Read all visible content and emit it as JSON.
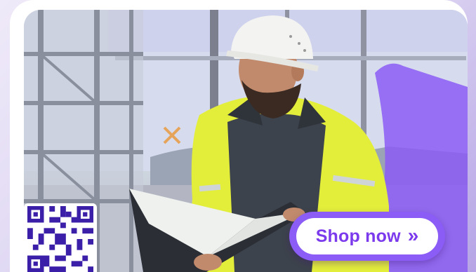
{
  "cta": {
    "label": "Shop now",
    "icon": "double-chevron-right-icon",
    "accent_color": "#8b5cf6",
    "text_color": "#7c3aed"
  },
  "qr": {
    "icon": "qr-code-icon",
    "color": "#3b1fa8"
  },
  "photo": {
    "subject": "construction-worker-image"
  }
}
